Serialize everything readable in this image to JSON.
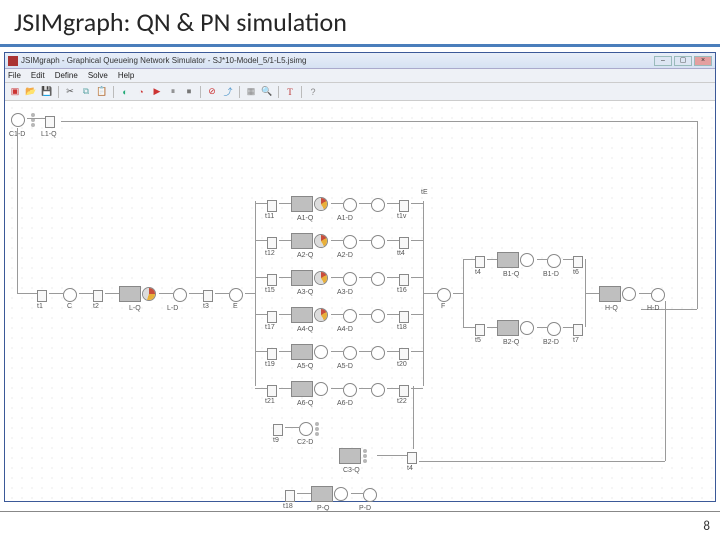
{
  "slide": {
    "title": "JSIMgraph: QN & PN simulation",
    "page_number": "8"
  },
  "window": {
    "title": "JSIMgraph - Graphical Queueing Network Simulator - SJ*10-Model_5/1-L5.jsimg",
    "menus": [
      "File",
      "Edit",
      "Define",
      "Solve",
      "Help"
    ],
    "toolbar_icons": [
      "new-icon",
      "open-icon",
      "save-icon",
      "cut-icon",
      "copy-icon",
      "paste-icon",
      "sep",
      "class-icon",
      "measure-icon",
      "what-if-icon",
      "sim-icon",
      "pause-icon",
      "stop-icon",
      "sep",
      "rotate-icon",
      "optimize-icon",
      "sep",
      "to-jmva-icon",
      "to-jaba-icon",
      "sep",
      "help-icon",
      "about-icon"
    ]
  },
  "nodes": {
    "source": {
      "label": "C1-D"
    },
    "L": {
      "q": "L1-Q"
    },
    "t1": {
      "label": "t1"
    },
    "C": {
      "label": "C"
    },
    "t2": {
      "label": "t2"
    },
    "LQ": {
      "q": "L-Q",
      "d": "L-D"
    },
    "t3": {
      "label": "t3"
    },
    "E": {
      "label": "E"
    },
    "rows": [
      {
        "tl": "t11",
        "q": "A1-Q",
        "d": "A1-D",
        "tr": "t1v",
        "end": "tE"
      },
      {
        "tl": "t12",
        "q": "A2-Q",
        "d": "A2-D",
        "tr": "tt4",
        "end": ""
      },
      {
        "tl": "t15",
        "q": "A3-Q",
        "d": "A3-D",
        "tr": "t16",
        "end": ""
      },
      {
        "tl": "t17",
        "q": "A4-Q",
        "d": "A4-D",
        "tr": "t18",
        "end": ""
      },
      {
        "tl": "t19",
        "q": "A5-Q",
        "d": "A5-D",
        "tr": "t20",
        "end": ""
      },
      {
        "tl": "t21",
        "q": "A6-Q",
        "d": "A6-D",
        "tr": "t22",
        "end": ""
      }
    ],
    "F": {
      "label": "F"
    },
    "B1": {
      "tl": "t4",
      "q": "B1-Q",
      "d": "B1-D",
      "tr": "t6"
    },
    "B2": {
      "tl": "t5",
      "q": "B2-Q",
      "d": "B2-D",
      "tr": "t7"
    },
    "H": {
      "q": "H-Q",
      "d": "H-D"
    },
    "C2": {
      "tl": "t9",
      "d": "C2-D"
    },
    "C3": {
      "q": "C3-Q"
    },
    "t4b": {
      "label": "t4"
    },
    "P": {
      "tl": "t18",
      "q": "P-Q",
      "d": "P-D"
    }
  }
}
